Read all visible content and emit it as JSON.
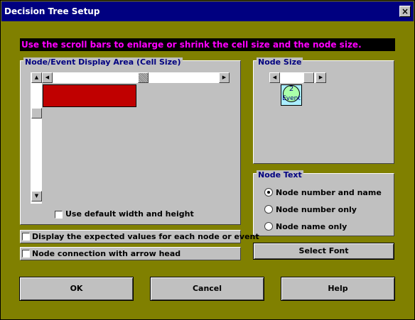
{
  "window": {
    "title": "Decision Tree Setup",
    "close_label": "×"
  },
  "instruction": "Use the scroll bars to enlarge or shrink the cell size and the node size.",
  "display_area": {
    "title": "Node/Event Display Area (Cell Size)",
    "default_checkbox_label": "Use default width and height",
    "default_checked": false,
    "cell_color": "#c00000"
  },
  "node_size": {
    "title": "Node Size",
    "node_number": "2",
    "node_label": "Event",
    "node_color": "#aaffaa",
    "node_bg": "#aaeeff"
  },
  "node_text": {
    "title": "Node Text",
    "options": [
      {
        "label": "Node number and name",
        "selected": true
      },
      {
        "label": "Node number only",
        "selected": false
      },
      {
        "label": "Node name only",
        "selected": false
      }
    ]
  },
  "checkboxes": {
    "expected_values": "Display the expected values for each node or event",
    "arrow_head": "Node connection with arrow head"
  },
  "buttons": {
    "select_font": "Select Font",
    "ok": "OK",
    "cancel": "Cancel",
    "help": "Help"
  }
}
